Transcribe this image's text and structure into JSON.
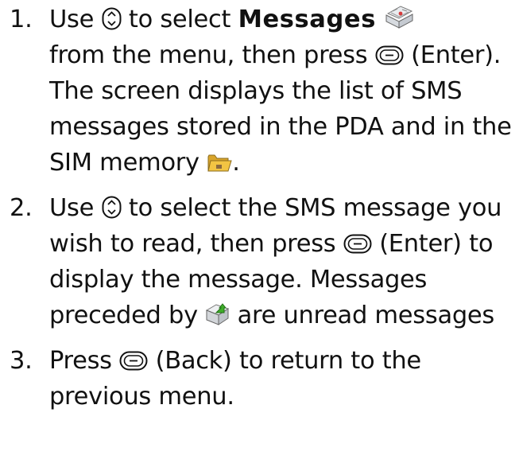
{
  "steps": [
    {
      "number": "1.",
      "parts": {
        "a": "Use",
        "b": "to select",
        "c": "Messages",
        "d": "from the menu, then press",
        "e": "(Enter). The screen displays the list of SMS messages stored in the PDA and in the SIM memory",
        "f": "."
      }
    },
    {
      "number": "2.",
      "parts": {
        "a": "Use",
        "b": "to select the SMS message you wish to read, then press",
        "c": "(Enter) to display the message. Messages preceded by",
        "d": "are unread messages"
      }
    },
    {
      "number": "3.",
      "parts": {
        "a": "Press",
        "b": "(Back) to return to the previous menu."
      }
    }
  ],
  "icons": {
    "navigation": "nav-key-icon",
    "enter": "enter-key-icon",
    "messages": "messages-envelope-icon",
    "sim_folder": "folder-icon",
    "unread": "unread-envelope-icon"
  },
  "colors": {
    "text": "#111111",
    "folder_yellow": "#f2c443",
    "unread_green": "#3fae2a"
  }
}
